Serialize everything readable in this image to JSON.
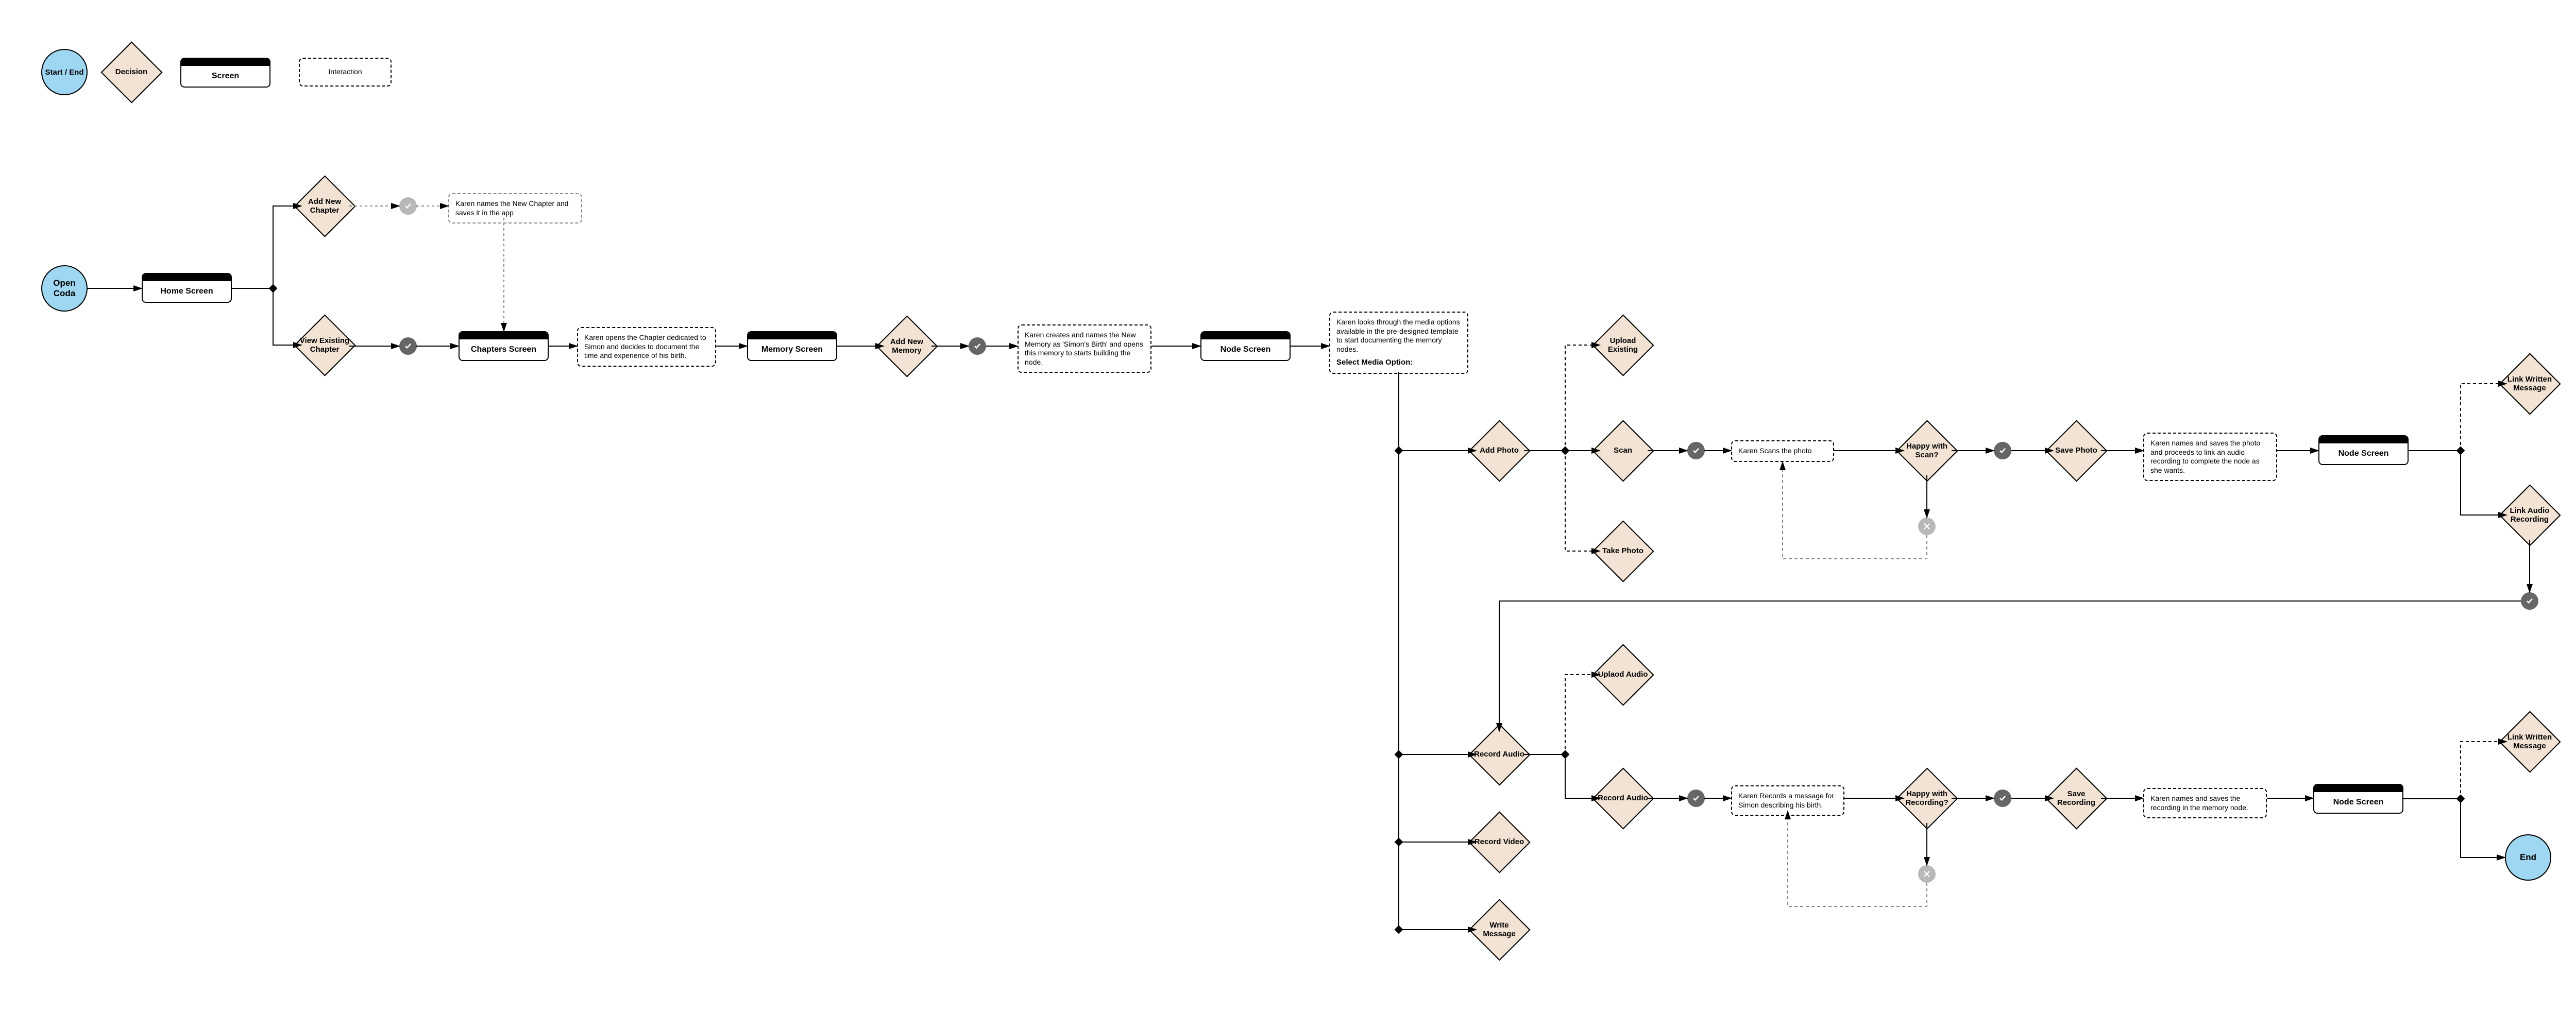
{
  "legend": {
    "start_end": "Start / End",
    "decision": "Decision",
    "screen": "Screen",
    "interaction": "Interaction"
  },
  "nodes": {
    "open_coda": "Open Coda",
    "home_screen": "Home Screen",
    "add_new_chapter": "Add New Chapter",
    "view_existing_chapter": "View Existing Chapter",
    "int_new_chapter": "Karen names the New Chapter and saves it in the app",
    "chapters_screen": "Chapters Screen",
    "int_open_chapter": "Karen opens the Chapter dedicated to Simon and decides to document the time and experience of his birth.",
    "memory_screen": "Memory Screen",
    "add_new_memory": "Add New Memory",
    "int_new_memory": "Karen creates and names the New Memory as 'Simon's Birth' and opens this memory to starts building the node.",
    "node_screen": "Node Screen",
    "int_media_options": "Karen looks through the media options available in the pre-designed template to start documenting the memory nodes.",
    "select_media": "Select Media Option:",
    "add_photo": "Add Photo",
    "record_audio": "Record Audio",
    "record_video": "Record Video",
    "write_message": "Write Message",
    "upload_existing": "Upload Existing",
    "scan": "Scan",
    "take_photo": "Take Photo",
    "int_scan": "Karen Scans the photo",
    "happy_scan": "Happy with Scan?",
    "save_photo": "Save Photo",
    "int_save_photo": "Karen names and saves the photo and proceeds to link an audio recording to complete the node as she wants.",
    "node_screen_2": "Node Screen",
    "link_written_message": "Link Written Message",
    "link_audio_recording": "Link Audio Recording",
    "upload_audio": "Uplaod Audio",
    "record_audio_2": "Record Audio",
    "int_record": "Karen Records a message for Simon describing his birth.",
    "happy_recording": "Happy with Recording?",
    "save_recording": "Save Recording",
    "int_save_recording": "Karen names and saves the recording in the memory node.",
    "node_screen_3": "Node Screen",
    "link_written_message_2": "Link Written Message",
    "end": "End"
  }
}
